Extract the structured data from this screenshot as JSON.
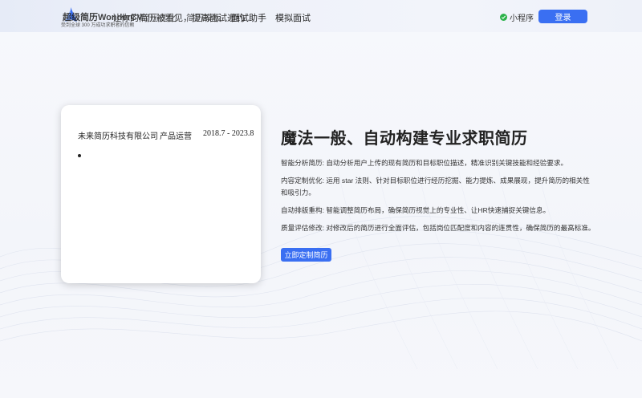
{
  "header": {
    "logo_title": "超级简历WonderCV",
    "slogan": "让你的简历被看见，提高面试邀约",
    "sub_slogan": "受到全球 300 万成功求职者的信赖",
    "nav": [
      "简历优化",
      "简历模板",
      "面试助手",
      "模拟面试"
    ],
    "mini_program": "小程序",
    "login": "登录"
  },
  "card": {
    "company": "未来简历科技有限公司",
    "role": "产品运营",
    "period": "2018.7 - 2023.8"
  },
  "main": {
    "headline": "魔法一般、自动构建专业求职简历",
    "features": [
      "智能分析简历: 自动分析用户上传的现有简历和目标职位描述，精准识别关键技能和经验要求。",
      "内容定制优化: 运用 star 法则、针对目标职位进行经历挖掘、能力提炼、成果展现，提升简历的相关性和吸引力。",
      "自动排版重构: 智能调整简历布局，确保简历视觉上的专业性、让HR快速捕捉关键信息。",
      "质量评估修改: 对修改后的简历进行全面评估，包括岗位匹配度和内容的连贯性，确保简历的最高标准。"
    ],
    "cta": "立即定制简历"
  },
  "colors": {
    "accent": "#3a6ff2",
    "status_green": "#2cb24a"
  }
}
